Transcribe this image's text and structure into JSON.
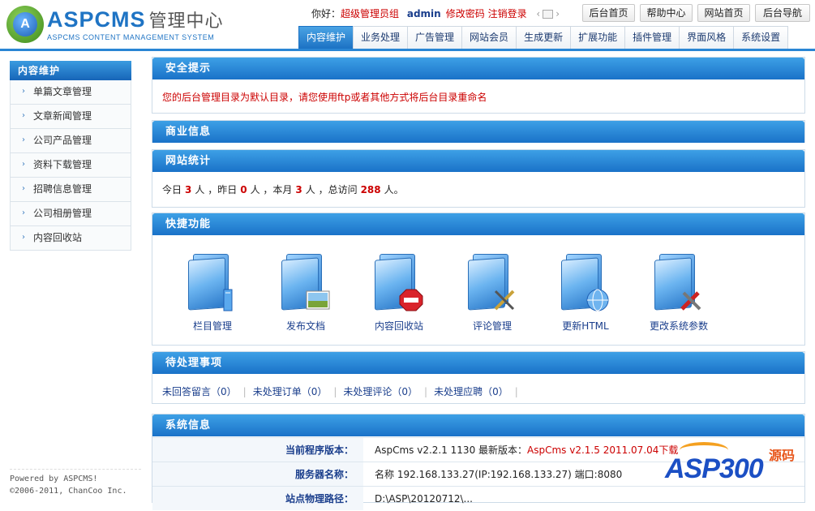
{
  "header": {
    "logo_text": "ASPCMS",
    "logo_sub": "管理中心",
    "logo_tagline": "ASPCMS CONTENT MANAGEMENT SYSTEM",
    "logo_badge": "A",
    "greeting": "你好：",
    "role": "超级管理员组",
    "username": "admin",
    "change_password": "修改密码",
    "logout": "注销登录",
    "top_buttons": [
      "后台首页",
      "帮助中心",
      "网站首页",
      "后台导航"
    ],
    "tabs": [
      "内容维护",
      "业务处理",
      "广告管理",
      "网站会员",
      "生成更新",
      "扩展功能",
      "插件管理",
      "界面风格",
      "系统设置"
    ],
    "active_tab": "内容维护"
  },
  "sidebar": {
    "title": "内容维护",
    "items": [
      "单篇文章管理",
      "文章新闻管理",
      "公司产品管理",
      "资料下载管理",
      "招聘信息管理",
      "公司相册管理",
      "内容回收站"
    ]
  },
  "footer": {
    "line1": "Powered by ASPCMS!",
    "line2": "©2006-2011, ChanCoo Inc."
  },
  "security": {
    "title": "安全提示",
    "message": "您的后台管理目录为默认目录，请您使用ftp或者其他方式将后台目录重命名"
  },
  "business": {
    "title": "商业信息"
  },
  "stats": {
    "title": "网站统计",
    "today_label": "今日",
    "today": "3",
    "yesterday_label": "人 ，昨日",
    "yesterday": "0",
    "month_label": "人 ，本月",
    "month": "3",
    "total_label": "人 ，总访问",
    "total": "288",
    "tail": "人。"
  },
  "quick": {
    "title": "快捷功能",
    "items": [
      {
        "label": "栏目管理",
        "icon": "folder-book-icon"
      },
      {
        "label": "发布文档",
        "icon": "folder-image-icon"
      },
      {
        "label": "内容回收站",
        "icon": "folder-delete-icon"
      },
      {
        "label": "评论管理",
        "icon": "folder-pen-icon"
      },
      {
        "label": "更新HTML",
        "icon": "folder-globe-icon"
      },
      {
        "label": "更改系统参数",
        "icon": "folder-tools-icon"
      }
    ]
  },
  "todo": {
    "title": "待处理事项",
    "items": [
      "未回答留言（0）",
      "未处理订单（0）",
      "未处理评论（0）",
      "未处理应聘（0）"
    ]
  },
  "sysinfo": {
    "title": "系统信息",
    "rows": [
      {
        "key": "当前程序版本：",
        "value": "AspCms v2.2.1 1130 最新版本：",
        "extra": "AspCms v2.1.5 2011.07.04下载"
      },
      {
        "key": "服务器名称：",
        "value": "名称 192.168.133.27(IP:192.168.133.27) 端口:8080",
        "extra": ""
      },
      {
        "key": "站点物理路径：",
        "value": "D:\\ASP\\20120712\\...",
        "extra": ""
      }
    ]
  },
  "watermark": {
    "text": "ASP300",
    "yuan": "源码"
  }
}
